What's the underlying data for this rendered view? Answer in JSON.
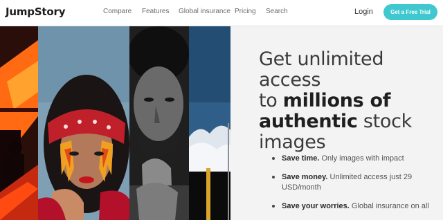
{
  "brand": {
    "name": "JumpStory"
  },
  "nav": {
    "items": [
      {
        "label": "Compare"
      },
      {
        "label": "Features"
      },
      {
        "label": "Global insurance"
      },
      {
        "label": "Pricing"
      },
      {
        "label": "Search"
      }
    ]
  },
  "header": {
    "login_label": "Login",
    "cta_label": "Get a Free Trial",
    "cta_color": "#3fc8cf"
  },
  "hero": {
    "headline": {
      "line1": "Get unlimited access",
      "to": "to ",
      "millions": "millions of",
      "authentic": "authentic",
      "stock": " stock",
      "images": "images"
    },
    "benefits": [
      {
        "lead": "Save time.",
        "text": " Only images with impact"
      },
      {
        "lead": "Save money.",
        "text": " Unlimited access just 29 USD/month"
      },
      {
        "lead": "Save your worries.",
        "text": " Global insurance on all"
      }
    ],
    "photos": [
      "orange-silhouette-photo",
      "woman-bandana-photo",
      "man-portrait-photo",
      "sky-photo"
    ]
  }
}
